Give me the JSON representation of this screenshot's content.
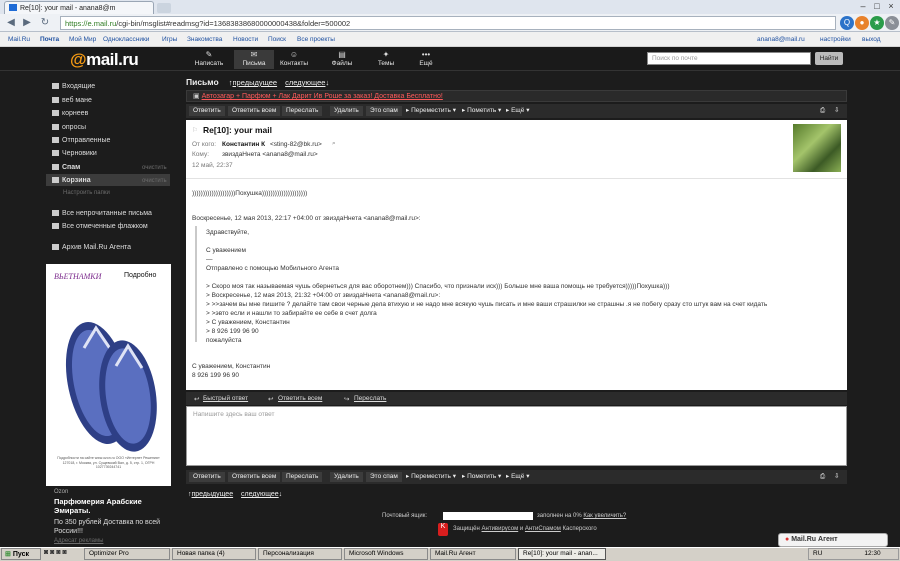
{
  "browser": {
    "tab_title": "Re[10]: your mail - anana8@m",
    "url_host": "https://e.mail.ru",
    "url_path": "/cgi-bin/msglist#readmsg?id=13683838680000000438&folder=500002"
  },
  "portal": {
    "links": [
      "Mail.Ru",
      "Почта",
      "Мой Мир",
      "Одноклассники",
      "Игры",
      "Знакомства",
      "Новости",
      "Поиск",
      "Все проекты"
    ],
    "user": "anana8@mail.ru",
    "settings": "настройки",
    "logout": "выход"
  },
  "header": {
    "logo_at": "@",
    "logo_text": "mail.ru",
    "nav": [
      "Написать",
      "Письма",
      "Контакты",
      "Файлы",
      "Темы",
      "Ещё"
    ],
    "search_placeholder": "Поиск по почте",
    "search_button": "Найти"
  },
  "sidebar": {
    "folders": [
      "Входящие",
      "веб мане",
      "корнеев",
      "опросы",
      "Отправленные",
      "Черновики",
      "Спам",
      "Корзина"
    ],
    "spam_clear": "очистить",
    "trash_clear": "очистить",
    "folder_settings": "Настроить папки",
    "filters": [
      "Все непрочитанные письма",
      "Все отмеченные флажком"
    ],
    "agent_archive": "Архив Mail.Ru Агента"
  },
  "ad": {
    "brand": "ВЬЕТНАМКИ",
    "more": "Подробно",
    "fine_print": "Подробности на сайте www.ozon.ru ООО «Интернет Решения» 127018, г. Москва, ул. Сущевский Вал, д. 5, стр. 1, ОГРН 1027739244741",
    "label": "Ozon",
    "title": "Парфюмерия Арабские Эмираты.",
    "body": "По 350 рублей Доставка по всей России!!!",
    "footer": "Адресат рекламы"
  },
  "message": {
    "section": "Письмо",
    "prev": "предыдущее",
    "next": "следующее",
    "promo": "Автозагар + Парфюм + Лак Дарит Ив Роше за заказ! Доставка Бесплатно!",
    "toolbar": {
      "reply": "Ответить",
      "reply_all": "Ответить всем",
      "forward": "Переслать",
      "delete": "Удалить",
      "spam": "Это спам",
      "move": "Переместить",
      "mark": "Пометить",
      "more": "Ещё"
    },
    "subject": "Re[10]: your mail",
    "from_label": "От кого:",
    "from_name": "Константин К",
    "from_email": "<sting-82@bk.ru>",
    "to_label": "Кому:",
    "to_value": "звиздаНнета <anana8@mail.ru>",
    "date": "12 май, 22:37",
    "body_line": "))))))))))))))))))))Похушка)))))))))))))))))))))",
    "quote_header": "Воскресенье, 12 мая 2013, 22:17 +04:00 от звиздаНнета <anana8@mail.ru>:",
    "quote_lines": [
      "Здравствуйте,",
      "",
      "С уважением",
      "—",
      "Отправлено с помощью Мобильного Агента",
      "",
      "> Скоро моя так называемая чушь обернеться для вас оборотнем))) Спасибо, что признали иск))) Больше мне ваша помощь не требуется)))))Похушка)))",
      "> Воскресенье, 12 мая 2013, 21:32 +04:00 от звиздаНнета <anana8@mail.ru>:",
      "> >>зачем вы мне пишите ? делайте там свои черные дела втихую и не надо мне всякую чушь писать и мне ваши страшилки не страшны .я не побегу сразу сто штук вам на счет кидать",
      "> >эвто если и нашли то забирайте ее себе в счет долга",
      "> С уважением, Константин",
      "> 8 926 199 96 90",
      "пожалуйста"
    ],
    "signature": [
      "С уважением, Константин",
      "8 926 199 96 90"
    ],
    "quick_reply": "Быстрый ответ",
    "reply_all_link": "Ответить всем",
    "forward_link": "Переслать",
    "reply_placeholder": "Напишите здесь ваш ответ"
  },
  "footer": {
    "quota_label": "Почтовый ящик:",
    "quota_text": "заполнен на 0%",
    "quota_link": "Как увеличить?",
    "quota_fill": 0,
    "security_prefix": "Защищён",
    "antivirus": "Антивирусом",
    "and": "и",
    "antispam": "АнтиСпамом",
    "kaspersky": "Касперского"
  },
  "agent": {
    "label": "Mail.Ru Агент"
  },
  "taskbar": {
    "start": "Пуск",
    "tasks": [
      "Optimizer Pro",
      "Новая папка (4)",
      "Персонализация",
      "Microsoft Windows",
      "Mail.Ru Агент",
      "Re[10]: your mail - anan..."
    ],
    "lang": "RU",
    "clock": "12:30"
  }
}
